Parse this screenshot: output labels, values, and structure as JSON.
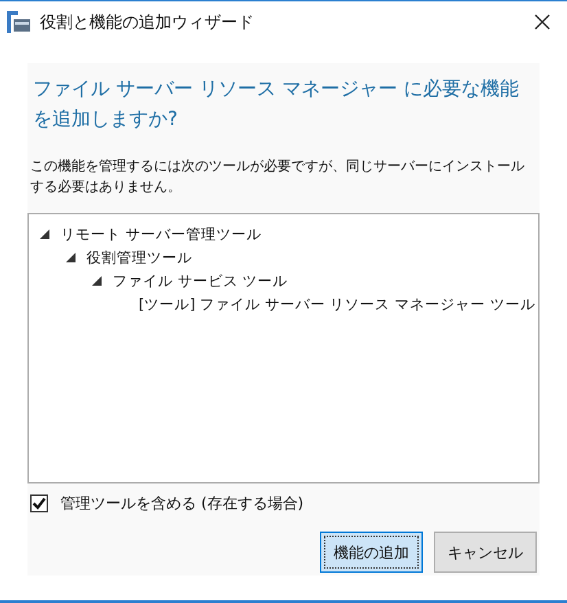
{
  "window": {
    "title": "役割と機能の追加ウィザード"
  },
  "heading": "ファイル サーバー リソース マネージャー に必要な機能を追加しますか?",
  "description": "この機能を管理するには次のツールが必要ですが、同じサーバーにインストールする必要はありません。",
  "tree": [
    {
      "label": "リモート サーバー管理ツール",
      "expanded": true,
      "children": [
        {
          "label": "役割管理ツール",
          "expanded": true,
          "children": [
            {
              "label": "ファイル サービス ツール",
              "expanded": true,
              "children": [
                {
                  "label": "[ツール] ファイル サーバー リソース マネージャー ツール"
                }
              ]
            }
          ]
        }
      ]
    }
  ],
  "include_tools": {
    "label": "管理ツールを含める (存在する場合)",
    "checked": true
  },
  "buttons": [
    {
      "label": "機能の追加",
      "kind": "default"
    },
    {
      "label": "キャンセル",
      "kind": "normal"
    }
  ]
}
